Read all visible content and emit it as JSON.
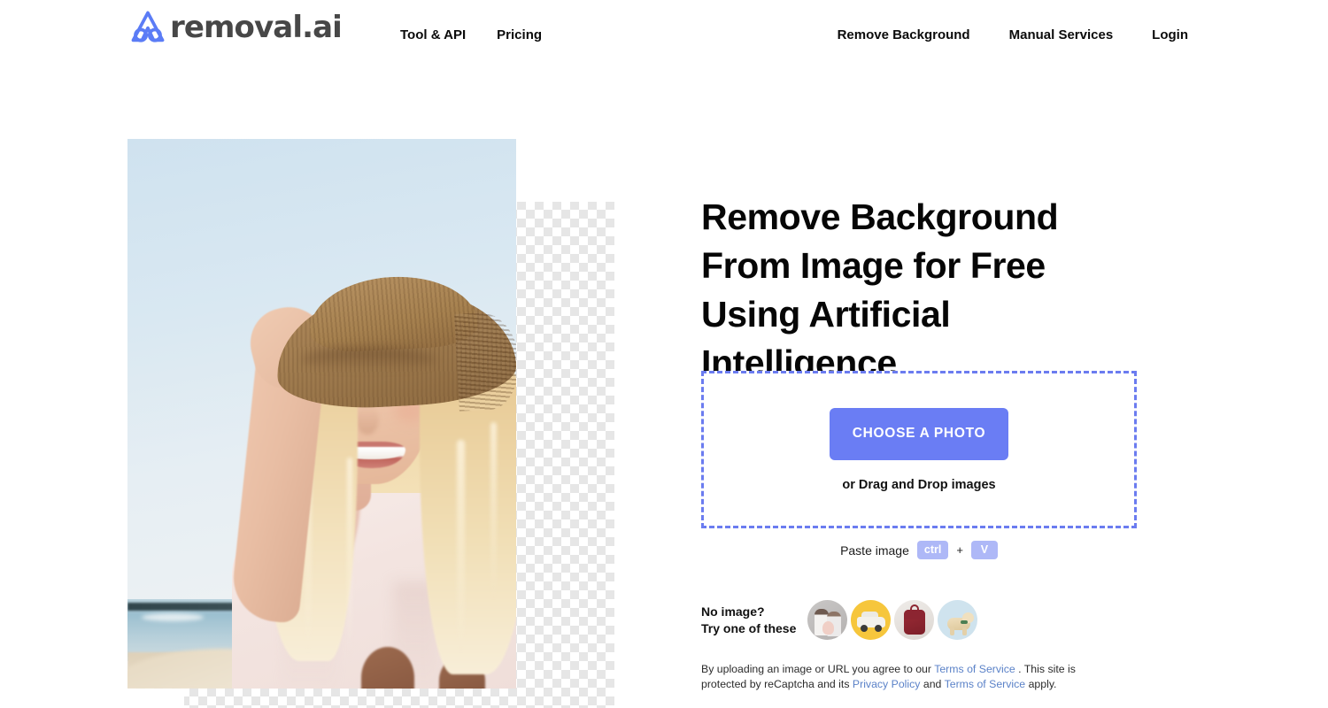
{
  "brand": {
    "name": "removal.ai",
    "logo_icon": "removal-ai-logo-icon",
    "accent_color": "#6a7df4"
  },
  "header": {
    "nav_left": [
      {
        "label": "Tool & API"
      },
      {
        "label": "Pricing"
      }
    ],
    "nav_right": [
      {
        "label": "Remove Background"
      },
      {
        "label": "Manual Services"
      },
      {
        "label": "Login"
      }
    ]
  },
  "hero": {
    "title": "Remove Background From Image for Free Using Artificial Intelligence",
    "image_alt": "Smiling blonde woman wearing a straw hat at the beach with background partially removed showing transparency checkerboard"
  },
  "dropzone": {
    "button_label": "CHOOSE A PHOTO",
    "drag_hint": "or Drag and Drop images",
    "border_color": "#6b7cf0"
  },
  "paste": {
    "label": "Paste image",
    "key_modifier": "ctrl",
    "separator": "+",
    "key_letter": "V",
    "key_bg": "#aeb8f7"
  },
  "samples": {
    "label_line1": "No image?",
    "label_line2": "Try one of these",
    "thumbs": [
      {
        "name": "sample-people",
        "alt": "Family with baby"
      },
      {
        "name": "sample-car",
        "alt": "Vintage white car on yellow"
      },
      {
        "name": "sample-backpack",
        "alt": "Red backpack"
      },
      {
        "name": "sample-dog",
        "alt": "Golden retriever dog"
      }
    ]
  },
  "legal": {
    "part1": "By uploading an image or URL you agree to our ",
    "link1": "Terms of Service",
    "part2": " . This site is protected by reCaptcha and its ",
    "link2": "Privacy Policy",
    "part3": " and ",
    "link3": "Terms of Service",
    "part4": " apply.",
    "link_color": "#5b82c8"
  }
}
